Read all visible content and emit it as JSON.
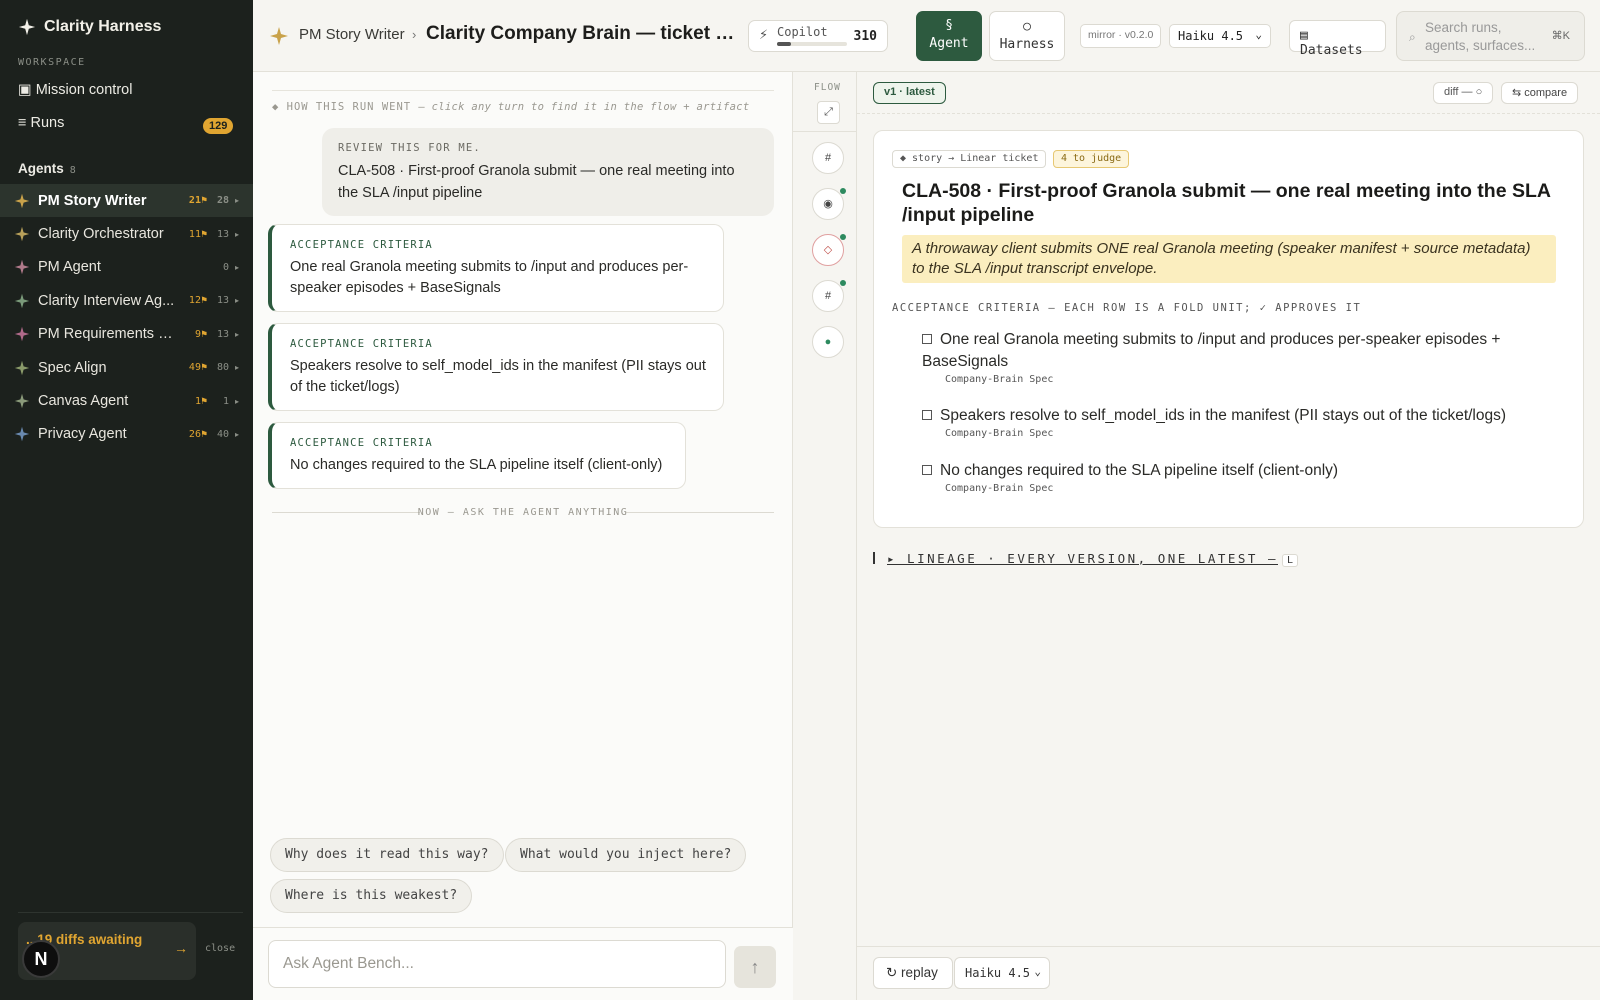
{
  "app": {
    "name": "Clarity Harness"
  },
  "sidebar": {
    "workspace_label": "WORKSPACE",
    "nav": [
      {
        "icon": "square-icon",
        "label": "▣ Mission control"
      },
      {
        "icon": "list-icon",
        "label": "≡ Runs",
        "badge": "129"
      }
    ],
    "agents_label": "Agents",
    "agents_count": "8",
    "agents": [
      {
        "name": "PM Story Writer",
        "m1": "21⚑",
        "m2": "28",
        "color": "#c9a24a",
        "active": true
      },
      {
        "name": "Clarity Orchestrator",
        "m1": "11⚑",
        "m2": "13",
        "color": "#b8a05a"
      },
      {
        "name": "PM Agent",
        "m1": "",
        "m2": "0",
        "color": "#b07a8a"
      },
      {
        "name": "Clarity Interview Ag...",
        "m1": "12⚑",
        "m2": "13",
        "color": "#7a9a7a"
      },
      {
        "name": "PM Requirements Sy...",
        "m1": "9⚑",
        "m2": "13",
        "color": "#b06a8a"
      },
      {
        "name": "Spec Align",
        "m1": "49⚑",
        "m2": "80",
        "color": "#8a9a6a"
      },
      {
        "name": "Canvas Agent",
        "m1": "1⚑",
        "m2": "1",
        "color": "#8a9a7a"
      },
      {
        "name": "Privacy Agent",
        "m1": "26⚑",
        "m2": "40",
        "color": "#6a8ab0"
      }
    ],
    "diffs_text": "...19 diffs awaiting",
    "close_label": "close",
    "avatar_letter": "N"
  },
  "topbar": {
    "crumb_agent": "PM Story Writer",
    "crumb_sep": "›",
    "crumb_title": "Clarity Company Brain — ticket set ...",
    "copilot_label": "Copilot",
    "copilot_value": "310",
    "copilot_fill_fraction": 0.2,
    "agent_btn_icon": "§",
    "agent_btn_label": "Agent",
    "harness_btn_icon": "○",
    "harness_btn_label": "Harness",
    "mirror_label": "mirror · v0.2.0",
    "model": "Haiku 4.5",
    "datasets_label": "▤ Datasets",
    "search_placeholder": "Search runs, agents, surfaces...",
    "search_kbd": "⌘K"
  },
  "conversation": {
    "run_header_prefix": "◆ HOW THIS RUN WENT",
    "run_header_hint": "— click any turn to find it in the flow + artifact",
    "user_tag": "REVIEW THIS FOR ME.",
    "user_text": "CLA-508 · First-proof Granola submit — one real meeting into the SLA /input pipeline",
    "cards": [
      {
        "tag": "ACCEPTANCE CRITERIA",
        "text": "One real Granola meeting submits to /input and produces per-speaker episodes + BaseSignals"
      },
      {
        "tag": "ACCEPTANCE CRITERIA",
        "text": "Speakers resolve to self_model_ids in the manifest (PII stays out of the ticket/logs)"
      },
      {
        "tag": "ACCEPTANCE CRITERIA",
        "text": "No changes required to the SLA pipeline itself (client-only)"
      }
    ],
    "now_divider": "NOW — ASK THE AGENT ANYTHING",
    "chips": [
      "Why does it read this way?",
      "What would you inject here?",
      "Where is this weakest?"
    ],
    "input_placeholder": "Ask Agent Bench...",
    "send_icon": "↑"
  },
  "flow": {
    "label": "FLOW",
    "expand_icon": "⤢",
    "nodes": [
      {
        "glyph": "#",
        "dot": false
      },
      {
        "glyph": "◉",
        "dot": true
      },
      {
        "glyph": "◇",
        "dot": true
      },
      {
        "glyph": "#",
        "dot": true
      },
      {
        "glyph": "●",
        "dot": false
      }
    ]
  },
  "artifact": {
    "version_pill": "v1 · latest",
    "diff_label": "diff — ○",
    "compare_label": "⇆ compare",
    "tag_story": "◆ story → Linear ticket",
    "tag_judge": "4 to judge",
    "title": "CLA-508 · First-proof Granola submit — one real meeting into the SLA /input pipeline",
    "highlight": "A throwaway client submits ONE real Granola meeting (speaker manifest + source metadata) to the SLA /input transcript envelope.",
    "ac_header": "ACCEPTANCE CRITERIA — EACH ROW IS A FOLD UNIT; ✓ APPROVES IT",
    "ac_items": [
      {
        "text": "One real Granola meeting submits to /input and produces per-speaker episodes + BaseSignals",
        "source": "Company-Brain Spec"
      },
      {
        "text": "Speakers resolve to self_model_ids in the manifest (PII stays out of the ticket/logs)",
        "source": "Company-Brain Spec"
      },
      {
        "text": "No changes required to the SLA pipeline itself (client-only)",
        "source": "Company-Brain Spec"
      }
    ],
    "lineage_label": "▸ LINEAGE · EVERY VERSION, ONE LATEST —",
    "lineage_kbd": "L",
    "replay_label": "↻ replay",
    "footer_model": "Haiku 4.5"
  }
}
